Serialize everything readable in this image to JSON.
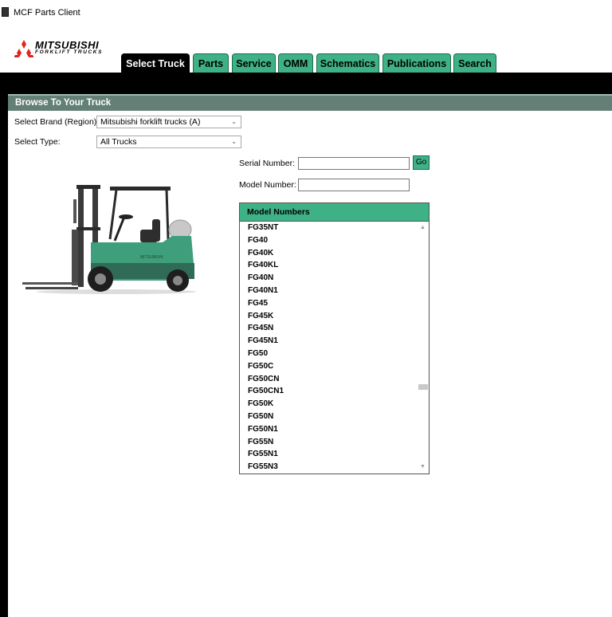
{
  "window": {
    "title": "MCF Parts Client"
  },
  "logo": {
    "brand": "MITSUBISHI",
    "subtitle": "FORKLIFT TRUCKS"
  },
  "tabs": [
    {
      "label": "Select Truck",
      "active": true
    },
    {
      "label": "Parts",
      "active": false
    },
    {
      "label": "Service",
      "active": false
    },
    {
      "label": "OMM",
      "active": false
    },
    {
      "label": "Schematics",
      "active": false
    },
    {
      "label": "Publications",
      "active": false
    },
    {
      "label": "Search",
      "active": false
    }
  ],
  "panel": {
    "title": "Browse To Your Truck"
  },
  "brand_select": {
    "label": "Select Brand (Region):",
    "value": "Mitsubishi forklift trucks (A)"
  },
  "type_select": {
    "label": "Select Type:",
    "value": "All Trucks"
  },
  "serial": {
    "label": "Serial Number:",
    "value": "",
    "go_label": "Go"
  },
  "model": {
    "label": "Model Number:",
    "value": ""
  },
  "model_list": {
    "header": "Model Numbers",
    "items": [
      "FG35NT",
      "FG40",
      "FG40K",
      "FG40KL",
      "FG40N",
      "FG40N1",
      "FG45",
      "FG45K",
      "FG45N",
      "FG45N1",
      "FG50",
      "FG50C",
      "FG50CN",
      "FG50CN1",
      "FG50K",
      "FG50N",
      "FG50N1",
      "FG55N",
      "FG55N1",
      "FG55N3"
    ]
  },
  "colors": {
    "accent": "#3fb187",
    "header_bar": "#637f76",
    "truck_body": "#3f9e7b"
  }
}
